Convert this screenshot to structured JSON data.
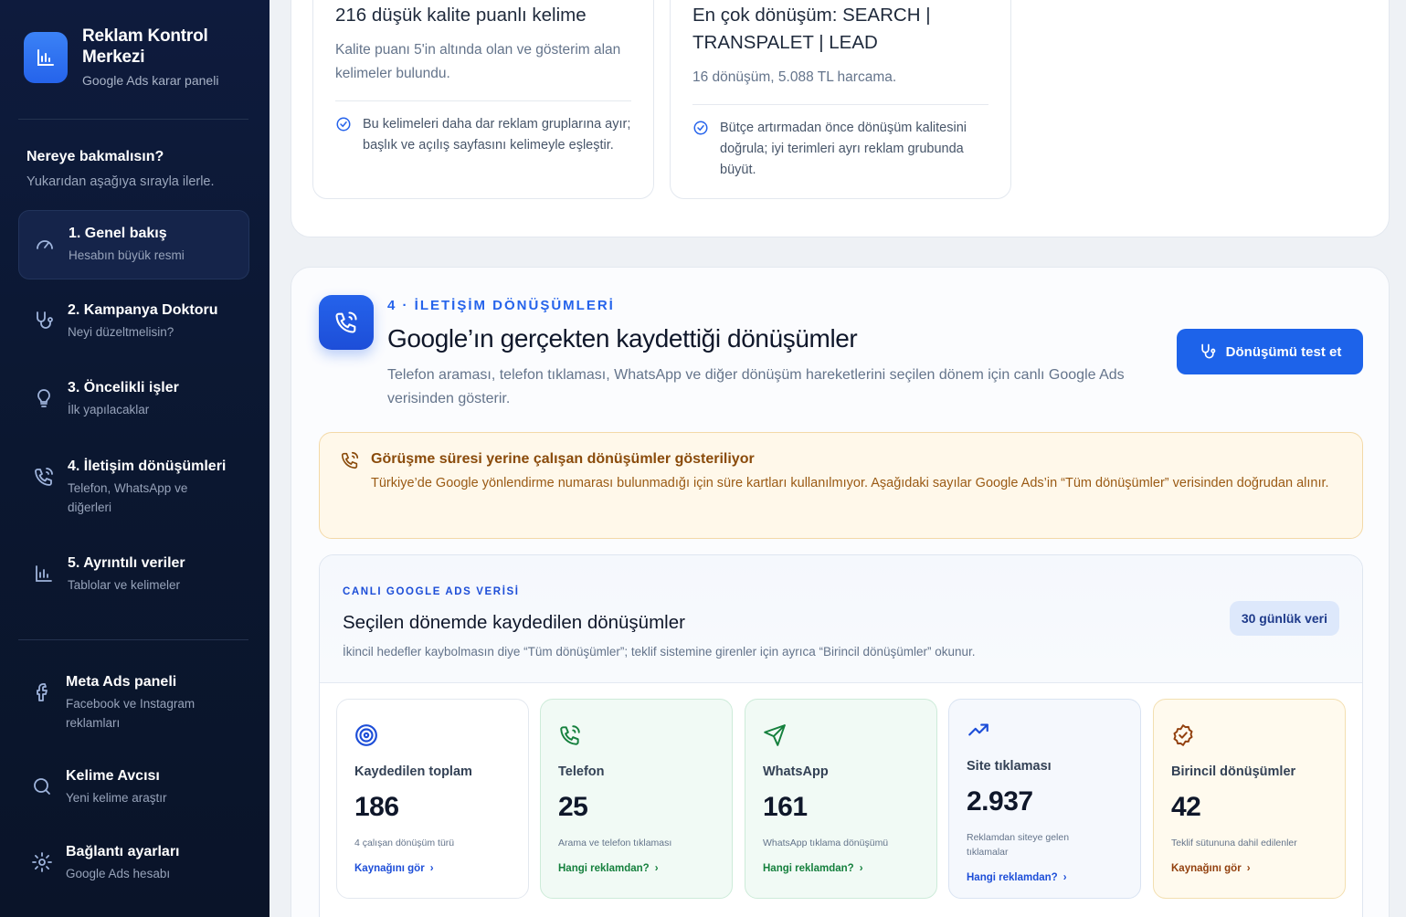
{
  "brand": {
    "title": "Reklam Kontrol Merkezi",
    "subtitle": "Google Ads karar paneli"
  },
  "nav": {
    "heading": "Nereye bakmalısın?",
    "subheading": "Yukarıdan aşağıya sırayla ilerle.",
    "items": [
      {
        "title": "1. Genel bakış",
        "sub": "Hesabın büyük resmi"
      },
      {
        "title": "2. Kampanya Doktoru",
        "sub": "Neyi düzeltmelisin?"
      },
      {
        "title": "3. Öncelikli işler",
        "sub": "İlk yapılacaklar"
      },
      {
        "title": "4. İletişim dönüşümleri",
        "sub": "Telefon, WhatsApp ve diğerleri"
      },
      {
        "title": "5. Ayrıntılı veriler",
        "sub": "Tablolar ve kelimeler"
      }
    ],
    "tools": [
      {
        "title": "Meta Ads paneli",
        "sub": "Facebook ve Instagram reklamları"
      },
      {
        "title": "Kelime Avcısı",
        "sub": "Yeni kelime araştır"
      },
      {
        "title": "Bağlantı ayarları",
        "sub": "Google Ads hesabı"
      }
    ]
  },
  "top_cards": [
    {
      "title": "216 düşük kalite puanlı kelime",
      "desc": "Kalite puanı 5'in altında olan ve gösterim alan kelimeler bulundu.",
      "note": "Bu kelimeleri daha dar reklam gruplarına ayır; başlık ve açılış sayfasını kelimeyle eşleştir."
    },
    {
      "title": "En çok dönüşüm: SEARCH | TRANSPALET | LEAD",
      "desc": "16 dönüşüm, 5.088 TL harcama.",
      "note": "Bütçe artırmadan önce dönüşüm kalitesini doğrula; iyi terimleri ayrı reklam grubunda büyüt."
    }
  ],
  "section": {
    "eyebrow": "4 · İLETİŞİM DÖNÜŞÜMLERİ",
    "title": "Google’ın gerçekten kaydettiği dönüşümler",
    "desc": "Telefon araması, telefon tıklaması, WhatsApp ve diğer dönüşüm hareketlerini seçilen dönem için canlı Google Ads verisinden gösterir.",
    "button": "Dönüşümü test et",
    "alert_title": "Görüşme süresi yerine çalışan dönüşümler gösteriliyor",
    "alert_text": "Türkiye’de Google yönlendirme numarası bulunmadığı için süre kartları kullanılmıyor. Aşağıdaki sayılar Google Ads’in “Tüm dönüşümler” verisinden doğrudan alınır."
  },
  "live": {
    "eyebrow": "CANLI GOOGLE ADS VERİSİ",
    "title": "Seçilen dönemde kaydedilen dönüşümler",
    "desc": "İkincil hedefler kaybolmasın diye “Tüm dönüşümler”; teklif sistemine girenler için ayrıca “Birincil dönüşümler” okunur.",
    "badge": "30 günlük veri",
    "stats": [
      {
        "label": "Kaydedilen toplam",
        "value": "186",
        "caption": "4 çalışan dönüşüm türü",
        "link": "Kaynağını gör",
        "icon": "target-icon",
        "color": "#1d4ed8"
      },
      {
        "label": "Telefon",
        "value": "25",
        "caption": "Arama ve telefon tıklaması",
        "link": "Hangi reklamdan?",
        "icon": "phone-icon",
        "color": "#15803d"
      },
      {
        "label": "WhatsApp",
        "value": "161",
        "caption": "WhatsApp tıklama dönüşümü",
        "link": "Hangi reklamdan?",
        "icon": "send-icon",
        "color": "#15803d"
      },
      {
        "label": "Site tıklaması",
        "value": "2.937",
        "caption": "Reklamdan siteye gelen tıklamalar",
        "link": "Hangi reklamdan?",
        "icon": "trend-up-icon",
        "color": "#1d4ed8"
      },
      {
        "label": "Birincil dönüşümler",
        "value": "42",
        "caption": "Teklif sütununa dahil edilenler",
        "link": "Kaynağını gör",
        "icon": "badge-check-icon",
        "color": "#92400e"
      }
    ]
  }
}
